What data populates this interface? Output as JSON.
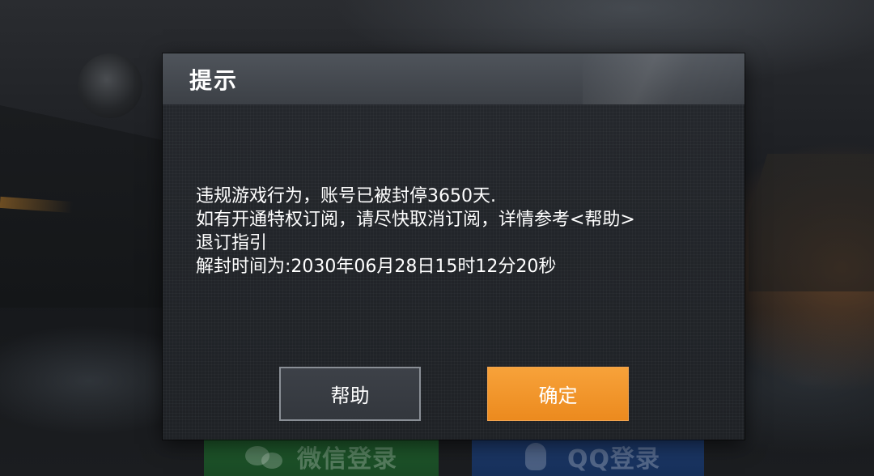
{
  "background": {
    "login_wechat_label": "微信登录",
    "login_qq_label": "QQ登录"
  },
  "dialog": {
    "title": "提示",
    "message_lines": [
      "违规游戏行为，账号已被封停3650天.",
      "如有开通特权订阅，请尽快取消订阅，详情参考<帮助>",
      "退订指引",
      "解封时间为:2030年06月28日15时12分20秒"
    ],
    "help_button_label": "帮助",
    "confirm_button_label": "确定"
  },
  "colors": {
    "confirm_button": "#F39A2E",
    "help_button_border": "#8A8F96",
    "header": "#474B51",
    "dialog_body": "#23262A"
  },
  "icons": {
    "wechat": "wechat-icon",
    "qq": "qq-penguin-icon"
  }
}
